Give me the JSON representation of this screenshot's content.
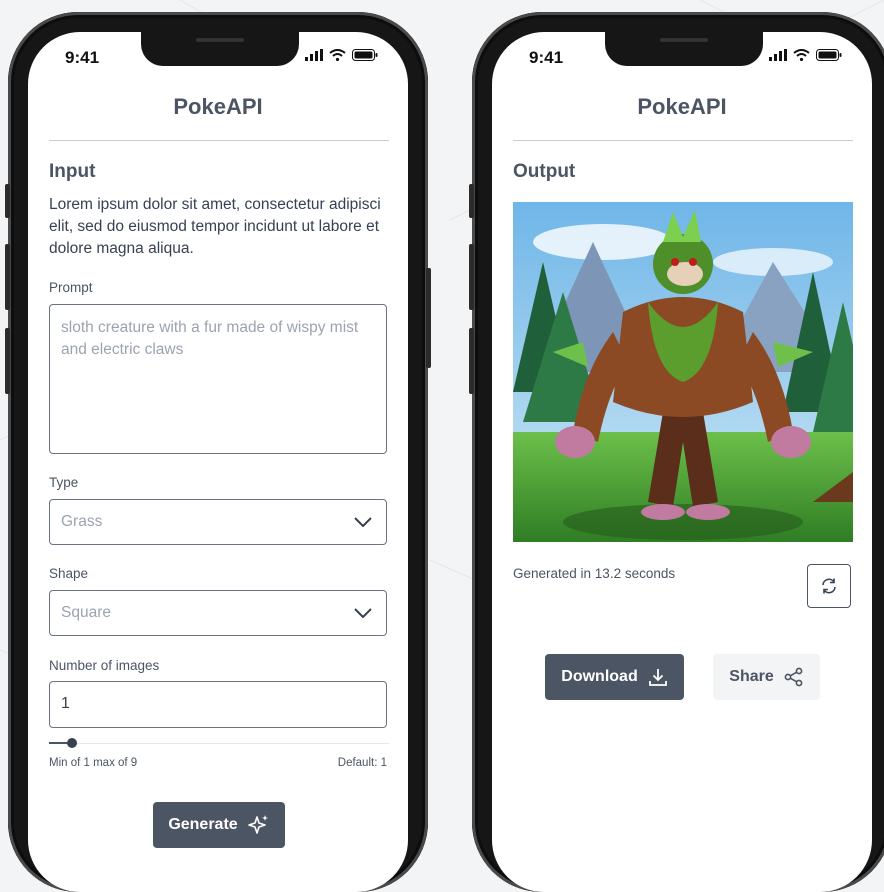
{
  "status": {
    "time": "9:41"
  },
  "left": {
    "title": "PokeAPI",
    "heading": "Input",
    "description": "Lorem ipsum dolor sit amet, consectetur adipisci elit, sed do eiusmod tempor incidunt ut labore et dolore magna aliqua.",
    "prompt": {
      "label": "Prompt",
      "placeholder": "sloth creature with a fur made of wispy mist and electric claws"
    },
    "type": {
      "label": "Type",
      "selected": "Grass"
    },
    "shape": {
      "label": "Shape",
      "selected": "Square"
    },
    "num_images": {
      "label": "Number of images",
      "value": "1",
      "min_max_hint": "Min of 1 max of 9",
      "default_hint": "Default: 1",
      "slider_fraction": 0.05
    },
    "generate_label": "Generate"
  },
  "right": {
    "title": "PokeAPI",
    "heading": "Output",
    "generated_text": "Generated in 13.2 seconds",
    "download_label": "Download",
    "share_label": "Share"
  },
  "colors": {
    "primary": "#4b5563",
    "secondary_bg": "#f3f4f6",
    "placeholder": "#9ca3af"
  },
  "icons": [
    "signal-icon",
    "wifi-icon",
    "battery-icon",
    "chevron-down-icon",
    "sparkle-icon",
    "refresh-icon",
    "download-icon",
    "share-icon"
  ]
}
